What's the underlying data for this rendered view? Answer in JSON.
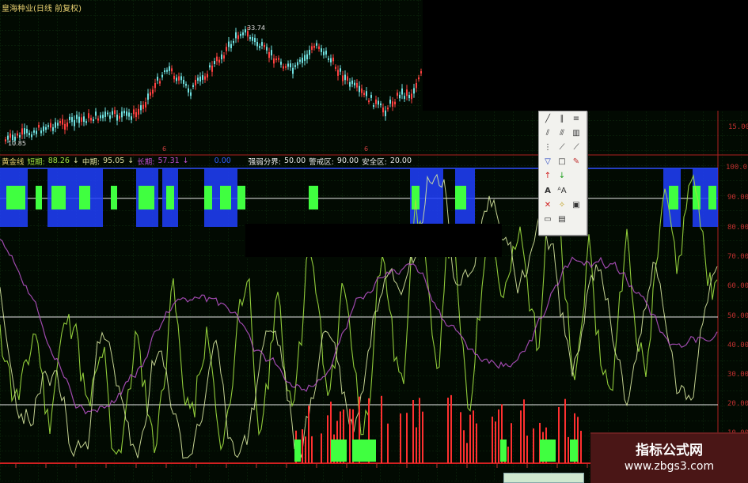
{
  "window": {
    "title": "皇海种业(日线 前复权)"
  },
  "price_panel": {
    "high_label": "33.74",
    "low_label": "10.85",
    "axis_value": "15.00",
    "marker_label": "6"
  },
  "indicator_bar": {
    "name": "黄金线",
    "short_label": "短期:",
    "short_value": "88.26",
    "mid_label": "中期:",
    "mid_value": "95.05",
    "long_label": "长期:",
    "long_value": "57.31",
    "extra_value": "0.00",
    "divide_label": "强弱分界:",
    "divide_value": "50.00",
    "alert_label": "警戒区:",
    "alert_value": "90.00",
    "safe_label": "安全区:",
    "safe_value": "20.00"
  },
  "y_axis": [
    "100.0",
    "90.00",
    "80.00",
    "70.00",
    "60.00",
    "50.00",
    "40.00",
    "30.00",
    "20.00",
    "10.00"
  ],
  "watermark": {
    "line1": "指标公式网",
    "line2": "www.zbgs3.com"
  },
  "toolbox": {
    "icons": [
      "line-tool-icon",
      "parallel-lines-icon",
      "fan-lines-icon",
      "channel-icon",
      "gann-icon",
      "fib-icon",
      "arrow-line-icon",
      "ray-icon",
      "pencil-icon",
      "triangle-icon",
      "rectangle-icon",
      "draw-icon",
      "up-arrow-icon",
      "down-arrow-icon",
      "text-tool-icon",
      "text-box-icon",
      "delete-icon",
      "magic-icon",
      "settings-icon",
      "hide-icon",
      "copy-icon"
    ]
  },
  "colors": {
    "background": "#020a02",
    "grid": "#0e2a0e",
    "candle_up": "#ff4040",
    "candle_down": "#70e0e0",
    "short_line": "#a0e040",
    "mid_line": "#d8e8a0",
    "long_line": "#b050c0",
    "green_block": "#40ff40",
    "blue_block": "#2040ff",
    "red_bar": "#ff3030"
  }
}
